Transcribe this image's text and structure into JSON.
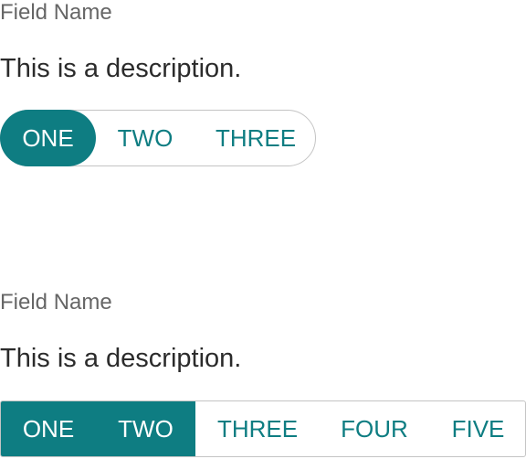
{
  "colors": {
    "accent": "#0e7d82",
    "selected_text": "#ffffff",
    "label_text": "#666666",
    "description_text": "#2b2b2b",
    "border": "#c4c4c4"
  },
  "field_one": {
    "label": "Field Name",
    "description": "This is a description.",
    "options": [
      {
        "label": "ONE",
        "selected": true
      },
      {
        "label": "TWO",
        "selected": false
      },
      {
        "label": "THREE",
        "selected": false
      }
    ]
  },
  "field_two": {
    "label": "Field Name",
    "description": "This is a description.",
    "options": [
      {
        "label": "ONE",
        "selected": true
      },
      {
        "label": "TWO",
        "selected": true
      },
      {
        "label": "THREE",
        "selected": false
      },
      {
        "label": "FOUR",
        "selected": false
      },
      {
        "label": "FIVE",
        "selected": false
      }
    ]
  }
}
